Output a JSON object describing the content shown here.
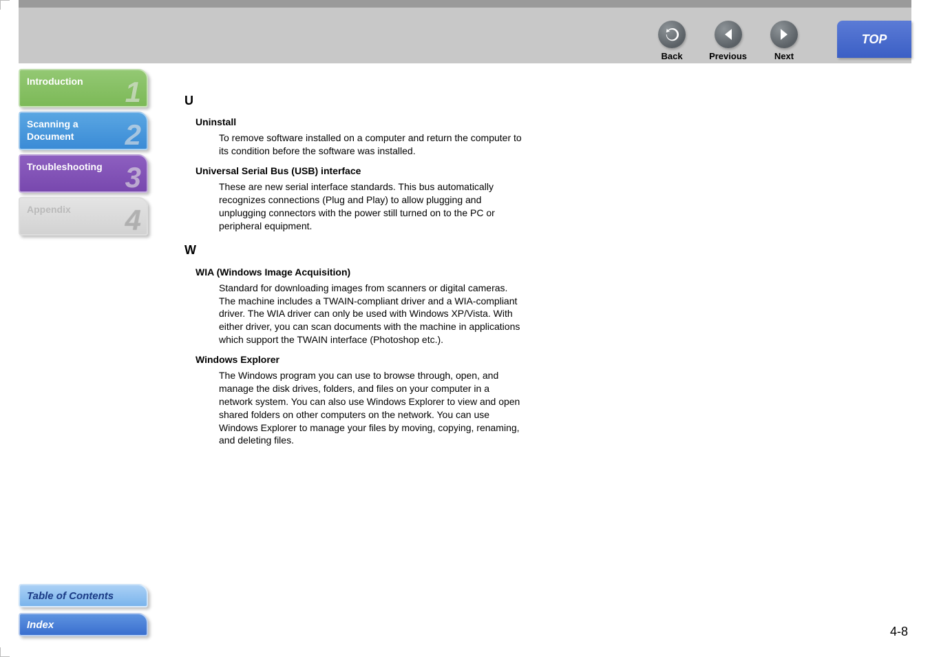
{
  "nav": {
    "back": {
      "label": "Back"
    },
    "previous": {
      "label": "Previous"
    },
    "next": {
      "label": "Next"
    },
    "top": {
      "label": "TOP"
    }
  },
  "chapters": [
    {
      "title": "Introduction",
      "num": "1"
    },
    {
      "title": "Scanning a\nDocument",
      "num": "2"
    },
    {
      "title": "Troubleshooting",
      "num": "3"
    },
    {
      "title": "Appendix",
      "num": "4"
    }
  ],
  "bottom": {
    "toc": "Table of Contents",
    "index": "Index"
  },
  "glossary": [
    {
      "letter": "U",
      "entries": [
        {
          "term": "Uninstall",
          "def": "To remove software installed on a computer and return the computer to its condition before the software was installed."
        },
        {
          "term": "Universal Serial Bus (USB) interface",
          "def": "These are new serial interface standards. This bus automatically recognizes connections (Plug and Play) to allow plugging and unplugging connectors with the power still turned on to the PC or peripheral equipment."
        }
      ]
    },
    {
      "letter": "W",
      "entries": [
        {
          "term": "WIA (Windows Image Acquisition)",
          "def": "Standard for downloading images from scanners or digital cameras. The machine includes a TWAIN-compliant driver and a WIA-compliant driver. The WIA driver can only be used with Windows XP/Vista. With either driver, you can scan documents with the machine in applications which support the TWAIN interface (Photoshop etc.)."
        },
        {
          "term": "Windows Explorer",
          "def": "The Windows program you can use to browse through, open, and manage the disk drives, folders, and files on your computer in a network system. You can also use Windows Explorer to view and open shared folders on other computers on the network. You can use Windows Explorer to manage your files by moving, copying, renaming, and deleting files."
        }
      ]
    }
  ],
  "page_number": "4-8"
}
